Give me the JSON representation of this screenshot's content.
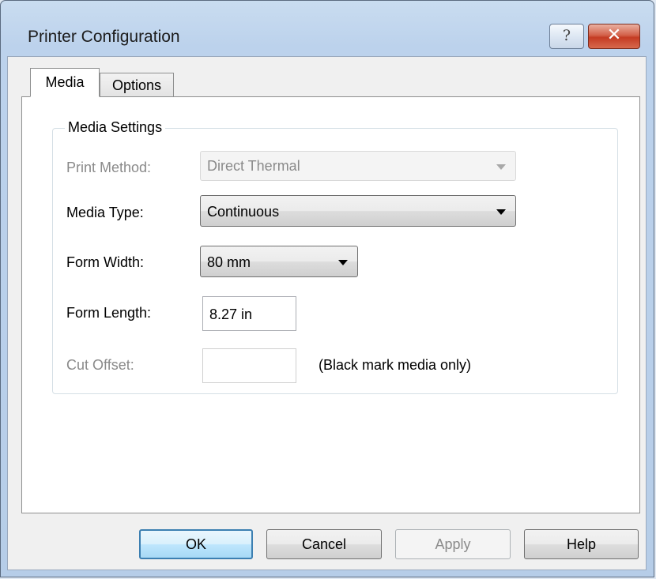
{
  "window": {
    "title": "Printer Configuration",
    "help_glyph": "?",
    "close_glyph": "✕"
  },
  "tabs": [
    {
      "label": "Media",
      "selected": true
    },
    {
      "label": "Options",
      "selected": false
    }
  ],
  "media_settings": {
    "group_label": "Media Settings",
    "print_method": {
      "label": "Print Method:",
      "value": "Direct Thermal",
      "enabled": false
    },
    "media_type": {
      "label": "Media Type:",
      "value": "Continuous",
      "enabled": true
    },
    "form_width": {
      "label": "Form Width:",
      "value": "80 mm",
      "enabled": true
    },
    "form_length": {
      "label": "Form Length:",
      "value": "8.27 in",
      "enabled": true
    },
    "cut_offset": {
      "label": "Cut Offset:",
      "value": "",
      "enabled": false,
      "note": "(Black mark media only)"
    }
  },
  "buttons": {
    "ok": "OK",
    "cancel": "Cancel",
    "apply": "Apply",
    "help": "Help"
  },
  "colors": {
    "title_bar": "#b6cde8",
    "close_button": "#c43b23",
    "default_button_border": "#3c7fb1"
  }
}
